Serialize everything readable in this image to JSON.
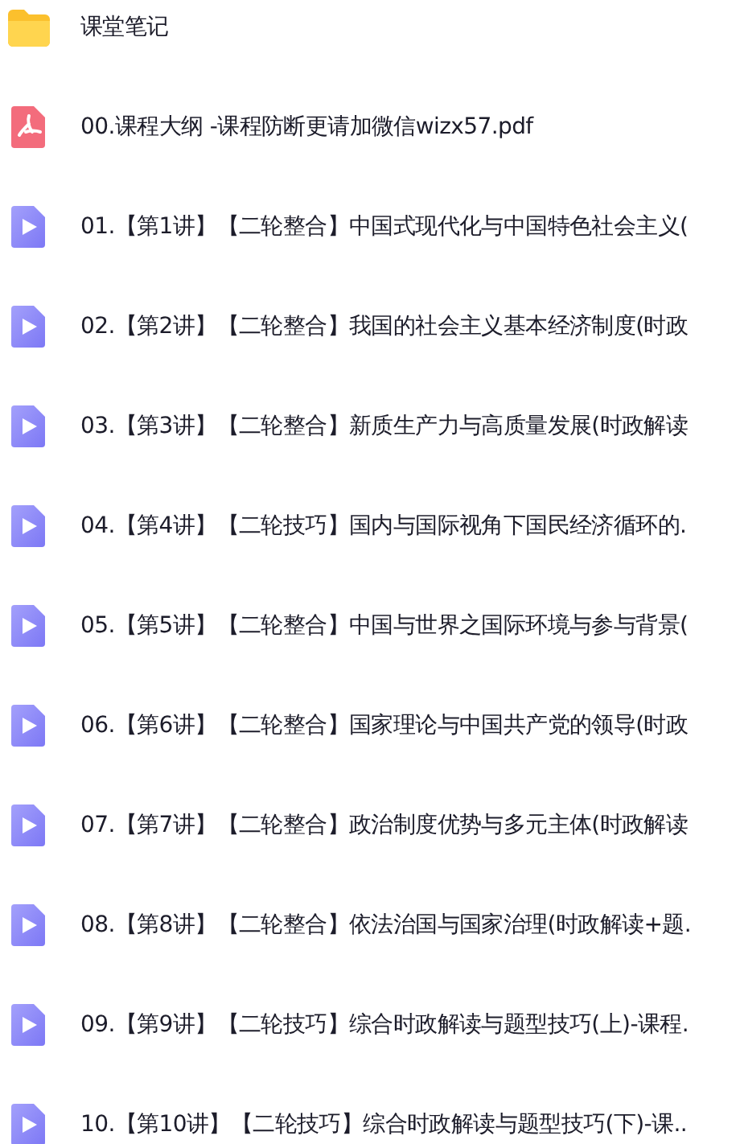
{
  "files": [
    {
      "kind": "folder",
      "name": "课堂笔记"
    },
    {
      "kind": "pdf",
      "name": "00.课程大纲 -课程防断更请加微信wizx57.pdf"
    },
    {
      "kind": "video",
      "name": "01.【第1讲】【二轮整合】中国式现代化与中国特色社会主义("
    },
    {
      "kind": "video",
      "name": "02.【第2讲】【二轮整合】我国的社会主义基本经济制度(时政"
    },
    {
      "kind": "video",
      "name": "03.【第3讲】【二轮整合】新质生产力与高质量发展(时政解读"
    },
    {
      "kind": "video",
      "name": "04.【第4讲】【二轮技巧】国内与国际视角下国民经济循环的."
    },
    {
      "kind": "video",
      "name": "05.【第5讲】【二轮整合】中国与世界之国际环境与参与背景("
    },
    {
      "kind": "video",
      "name": "06.【第6讲】【二轮整合】国家理论与中国共产党的领导(时政"
    },
    {
      "kind": "video",
      "name": "07.【第7讲】【二轮整合】政治制度优势与多元主体(时政解读"
    },
    {
      "kind": "video",
      "name": "08.【第8讲】【二轮整合】依法治国与国家治理(时政解读+题."
    },
    {
      "kind": "video",
      "name": "09.【第9讲】【二轮技巧】综合时政解读与题型技巧(上)-课程."
    },
    {
      "kind": "video",
      "name": "10.【第10讲】【二轮技巧】综合时政解读与题型技巧(下)-课.."
    }
  ]
}
